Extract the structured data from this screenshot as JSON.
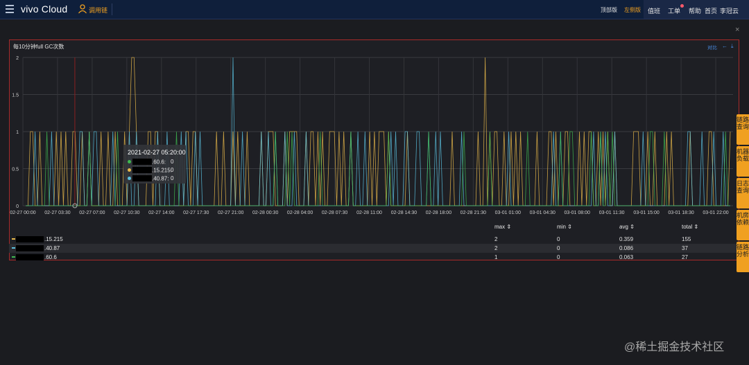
{
  "header": {
    "brand": "vivo Cloud",
    "user_tag": "调用链",
    "nav_top_layout": "顶部版",
    "nav_left_layout": "左侧版",
    "nav_items": [
      "值班",
      "工单",
      "帮助",
      "首页",
      "李冠云"
    ]
  },
  "panel": {
    "title": "每10分钟full GC次数",
    "compare_label": "对比",
    "close_label": "×"
  },
  "tooltip": {
    "time": "2021-02-27 05:20:00",
    "rows": [
      {
        "host": ".60.6:",
        "value": "0",
        "color": "#3fb950"
      },
      {
        "host": ".15.215:",
        "value": "0",
        "color": "#e8b84a"
      },
      {
        "host": ".40.87:",
        "value": "0",
        "color": "#5bc0de"
      }
    ]
  },
  "chart_data": {
    "type": "line",
    "ylim": [
      0,
      2
    ],
    "yticks": [
      "0",
      "0.5",
      "1",
      "1.5",
      "2"
    ],
    "xticks": [
      "02-27 00:00",
      "02-27 03:30",
      "02-27 07:00",
      "02-27 10:30",
      "02-27 14:00",
      "02-27 17:30",
      "02-27 21:00",
      "02-28 00:30",
      "02-28 04:00",
      "02-28 07:30",
      "02-28 11:00",
      "02-28 14:30",
      "02-28 18:00",
      "02-28 21:30",
      "03-01 01:00",
      "03-01 04:30",
      "03-01 08:00",
      "03-01 11:30",
      "03-01 15:00",
      "03-01 18:30",
      "03-01 22:00"
    ],
    "series": [
      {
        "name": ".15.215",
        "color": "#e8b84a",
        "max": 2,
        "min": 0,
        "avg": 0.359,
        "total": 155
      },
      {
        "name": ".40.87",
        "color": "#5bc0de",
        "max": 2,
        "min": 0,
        "avg": 0.086,
        "total": 37
      },
      {
        "name": ".60.6",
        "color": "#3fb950",
        "max": 1,
        "min": 0,
        "avg": 0.063,
        "total": 27
      }
    ]
  },
  "legend": {
    "headers": [
      "max",
      "min",
      "avg",
      "total"
    ],
    "rows": [
      {
        "host": ".15.215",
        "max": "2",
        "min": "0",
        "avg": "0.359",
        "total": "155",
        "color": "#e8b84a"
      },
      {
        "host": ".40.87",
        "max": "2",
        "min": "0",
        "avg": "0.086",
        "total": "37",
        "color": "#5bc0de"
      },
      {
        "host": ".60.6",
        "max": "1",
        "min": "0",
        "avg": "0.063",
        "total": "27",
        "color": "#3fb950"
      }
    ]
  },
  "side_tabs": [
    "链路查询",
    "机器负载",
    "日志查询",
    "机房依赖",
    "链路分析"
  ],
  "watermark": "@稀土掘金技术社区"
}
